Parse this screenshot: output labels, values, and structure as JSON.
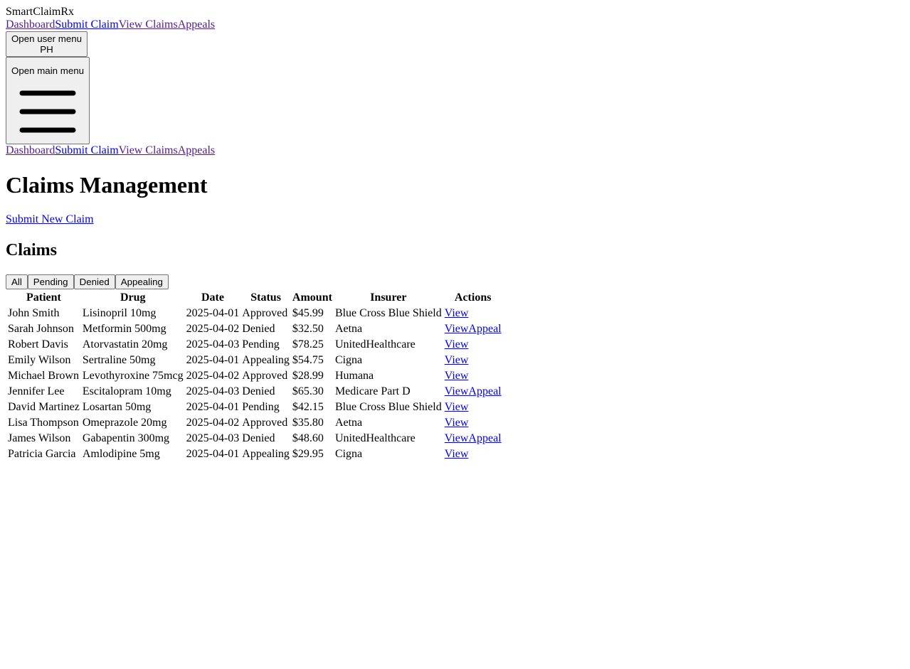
{
  "app": {
    "brand": "SmartClaimRx"
  },
  "nav": {
    "items": [
      {
        "label": "Dashboard"
      },
      {
        "label": "Submit Claim"
      },
      {
        "label": "View Claims"
      },
      {
        "label": "Appeals"
      }
    ]
  },
  "user_menu": {
    "sr_label": "Open user menu",
    "initials": "PH"
  },
  "main_menu": {
    "sr_label": "Open main menu",
    "icon": "hamburger-icon"
  },
  "mobile_nav": {
    "items": [
      {
        "label": "Dashboard"
      },
      {
        "label": "Submit Claim"
      },
      {
        "label": "View Claims"
      },
      {
        "label": "Appeals"
      }
    ]
  },
  "page": {
    "title": "Claims Management",
    "submit_new_label": "Submit New Claim",
    "section_title": "Claims"
  },
  "filters": [
    "All",
    "Pending",
    "Denied",
    "Appealing"
  ],
  "table": {
    "headers": [
      "Patient",
      "Drug",
      "Date",
      "Status",
      "Amount",
      "Insurer",
      "Actions"
    ],
    "view_label": "View",
    "appeal_label": "Appeal",
    "rows": [
      {
        "patient": "John Smith",
        "drug": "Lisinopril 10mg",
        "date": "2025-04-01",
        "status": "Approved",
        "amount": "$45.99",
        "insurer": "Blue Cross Blue Shield",
        "appeal": false
      },
      {
        "patient": "Sarah Johnson",
        "drug": "Metformin 500mg",
        "date": "2025-04-02",
        "status": "Denied",
        "amount": "$32.50",
        "insurer": "Aetna",
        "appeal": true
      },
      {
        "patient": "Robert Davis",
        "drug": "Atorvastatin 20mg",
        "date": "2025-04-03",
        "status": "Pending",
        "amount": "$78.25",
        "insurer": "UnitedHealthcare",
        "appeal": false
      },
      {
        "patient": "Emily Wilson",
        "drug": "Sertraline 50mg",
        "date": "2025-04-01",
        "status": "Appealing",
        "amount": "$54.75",
        "insurer": "Cigna",
        "appeal": false
      },
      {
        "patient": "Michael Brown",
        "drug": "Levothyroxine 75mcg",
        "date": "2025-04-02",
        "status": "Approved",
        "amount": "$28.99",
        "insurer": "Humana",
        "appeal": false
      },
      {
        "patient": "Jennifer Lee",
        "drug": "Escitalopram 10mg",
        "date": "2025-04-03",
        "status": "Denied",
        "amount": "$65.30",
        "insurer": "Medicare Part D",
        "appeal": true
      },
      {
        "patient": "David Martinez",
        "drug": "Losartan 50mg",
        "date": "2025-04-01",
        "status": "Pending",
        "amount": "$42.15",
        "insurer": "Blue Cross Blue Shield",
        "appeal": false
      },
      {
        "patient": "Lisa Thompson",
        "drug": "Omeprazole 20mg",
        "date": "2025-04-02",
        "status": "Approved",
        "amount": "$35.80",
        "insurer": "Aetna",
        "appeal": false
      },
      {
        "patient": "James Wilson",
        "drug": "Gabapentin 300mg",
        "date": "2025-04-03",
        "status": "Denied",
        "amount": "$48.60",
        "insurer": "UnitedHealthcare",
        "appeal": true
      },
      {
        "patient": "Patricia Garcia",
        "drug": "Amlodipine 5mg",
        "date": "2025-04-01",
        "status": "Appealing",
        "amount": "$29.95",
        "insurer": "Cigna",
        "appeal": false
      }
    ]
  }
}
